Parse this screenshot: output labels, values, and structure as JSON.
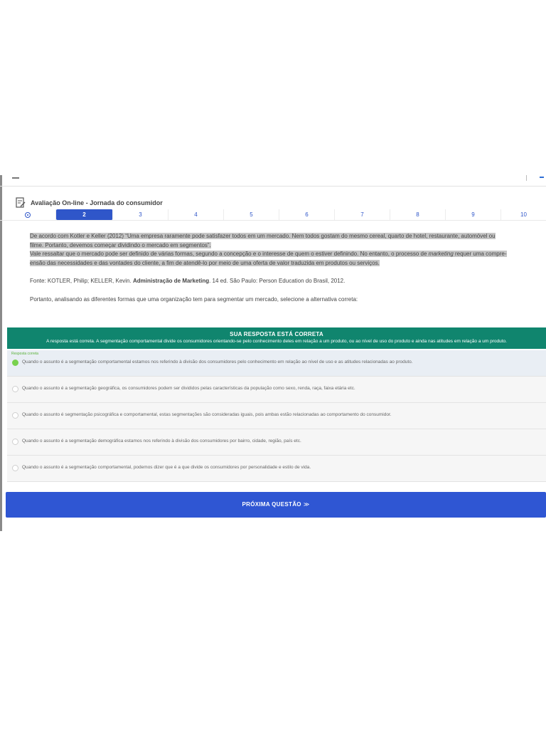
{
  "header": {
    "title": "Avaliação On-line - Jornada do consumidor"
  },
  "question_nav": {
    "current": 2,
    "items": [
      "2",
      "3",
      "4",
      "5",
      "6",
      "7",
      "8",
      "9",
      "10"
    ]
  },
  "passage": {
    "highlight_lines": [
      "De acordo com Kotler e Keller (2012) “Uma empresa raramente pode satisfazer todos em um mercado. Nem todos gostam do mesmo cereal, quarto de hotel, restaurante, automóvel ou",
      "filme. Portanto, devemos começar dividindo o mercado em segmentos”.",
      "Vale ressaltar que o mercado pode ser definido de várias formas, segundo a concepção e o interesse de quem o estiver definindo. No entanto, o processo de",
      "marketing",
      "requer uma compre-",
      "ensão das necessidades e das vontades do cliente, a fim de atendê-lo por meio de uma oferta de valor traduzida em produtos ou serviços."
    ],
    "source_prefix": "Fonte: KOTLER, Philip; KELLER, Kevin.",
    "source_title": "Administração de Marketing",
    "source_suffix": ". 14 ed. São Paulo: Person Education do Brasil, 2012.",
    "prompt": "Portanto, analisando as diferentes formas que uma organização tem para segmentar um mercado, selecione a alternativa correta:"
  },
  "feedback": {
    "title": "SUA RESPOSTA ESTÁ CORRETA",
    "text": "A resposta está correta. A segmentação comportamental divide os consumidores orientando-se pelo conhecimento deles em relação a um produto, ou ao nível de uso do produto e ainda nas atitudes em relação a um produto."
  },
  "answers": [
    {
      "tag": "Resposta correta",
      "text": "Quando o assunto é a segmentação comportamental estamos nos referindo à divisão dos consumidores pelo conhecimento em relação ao nível de uso e as atitudes relacionadas ao produto.",
      "selected": true
    },
    {
      "text": "Quando o assunto é a segmentação geográfica, os consumidores podem ser divididos pelas  características da população como sexo, renda, raça, faixa etária etc.",
      "selected": false
    },
    {
      "text": "Quando o assunto é segmentação psicográfica e comportamental, estas segmentações são consideradas iguais, pois ambas estão relacionadas ao comportamento do consumidor.",
      "selected": false
    },
    {
      "text": "Quando o assunto é a segmentação demográfica estamos nos referindo à divisão dos consumidores por bairro, cidade, região, país etc.",
      "selected": false
    },
    {
      "text": "Quando o assunto é a segmentação comportamental, podemos dizer que é a que divide os consumidores por personalidade e estilo de vida.",
      "selected": false
    }
  ],
  "next_button": {
    "label": "PRÓXIMA QUESTÃO",
    "arrow": "≫"
  },
  "colors": {
    "primary": "#2f56d3",
    "success_banner": "#10856e",
    "correct_radio": "#78d14e"
  }
}
